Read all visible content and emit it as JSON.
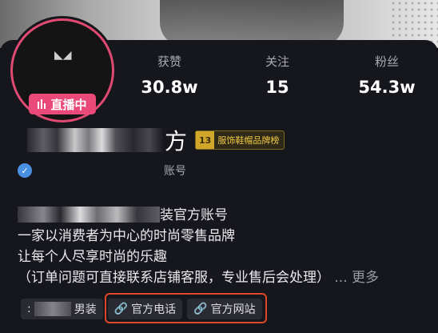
{
  "profile": {
    "live_label": "直播中",
    "name_tail": "方",
    "rank_badge": {
      "number": "13",
      "text": "服饰鞋帽品牌榜"
    },
    "verify_tail": "账号",
    "stats": [
      {
        "label": "获赞",
        "value": "30.8w"
      },
      {
        "label": "关注",
        "value": "15"
      },
      {
        "label": "粉丝",
        "value": "54.3w"
      }
    ],
    "bio": {
      "line1_tail": "装官方账号",
      "line2": "一家以消费者为中心的时尚零售品牌",
      "line3": "让每个人尽享时尚的乐趣",
      "line4": "（订单问题可直接联系店铺客服，专业售后会处理）",
      "more": "... 更多"
    },
    "tags": {
      "category_prefix": ":",
      "category_tail": "男装",
      "phone_label": "官方电话",
      "website_label": "官方网站"
    }
  },
  "colors": {
    "live": "#e94a79",
    "highlight": "#e0452a",
    "rank": "#f3c842"
  }
}
